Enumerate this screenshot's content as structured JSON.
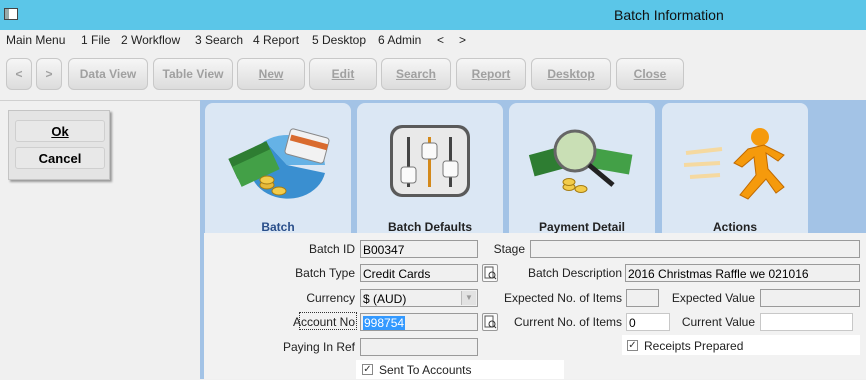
{
  "window": {
    "title": "Batch Information"
  },
  "menu": {
    "main": "Main Menu",
    "items": [
      "1 File",
      "2 Workflow",
      "3 Search",
      "4 Report",
      "5 Desktop",
      "6 Admin",
      "<",
      ">"
    ]
  },
  "toolbar": {
    "back": "<",
    "forward": ">",
    "buttons": [
      "Data View",
      "Table View",
      "New",
      "Edit",
      "Search",
      "Report",
      "Desktop",
      "Close"
    ]
  },
  "actions": {
    "ok": "Ok",
    "cancel": "Cancel"
  },
  "tabs": [
    {
      "label": "Batch",
      "icon": "money-card-pie-icon",
      "active": true
    },
    {
      "label": "Batch Defaults",
      "icon": "sliders-icon"
    },
    {
      "label": "Payment Detail",
      "icon": "magnifier-money-icon"
    },
    {
      "label": "Actions",
      "icon": "running-man-icon"
    }
  ],
  "form": {
    "batch_id": {
      "label": "Batch ID",
      "value": "B00347"
    },
    "stage": {
      "label": "Stage",
      "value": ""
    },
    "batch_type": {
      "label": "Batch Type",
      "value": "Credit Cards"
    },
    "batch_description": {
      "label": "Batch Description",
      "value": "2016 Christmas Raffle we 021016"
    },
    "currency": {
      "label": "Currency",
      "value": "$ (AUD)"
    },
    "expected_items": {
      "label": "Expected No. of Items",
      "value": ""
    },
    "expected_value": {
      "label": "Expected Value",
      "value": ""
    },
    "account_no": {
      "label": "Account No",
      "value": "998754"
    },
    "current_items": {
      "label": "Current No. of Items",
      "value": "0"
    },
    "current_value": {
      "label": "Current Value",
      "value": ""
    },
    "paying_in_ref": {
      "label": "Paying In Ref",
      "value": ""
    },
    "receipts_prepared": {
      "label": "Receipts Prepared",
      "checked": true
    },
    "sent_to_accounts": {
      "label": "Sent To Accounts",
      "checked": true
    }
  },
  "colors": {
    "titlebar": "#5bc6e8",
    "tab_area": "#a3c3e6",
    "tab": "#dbe7f4",
    "selection": "#3399ff"
  }
}
